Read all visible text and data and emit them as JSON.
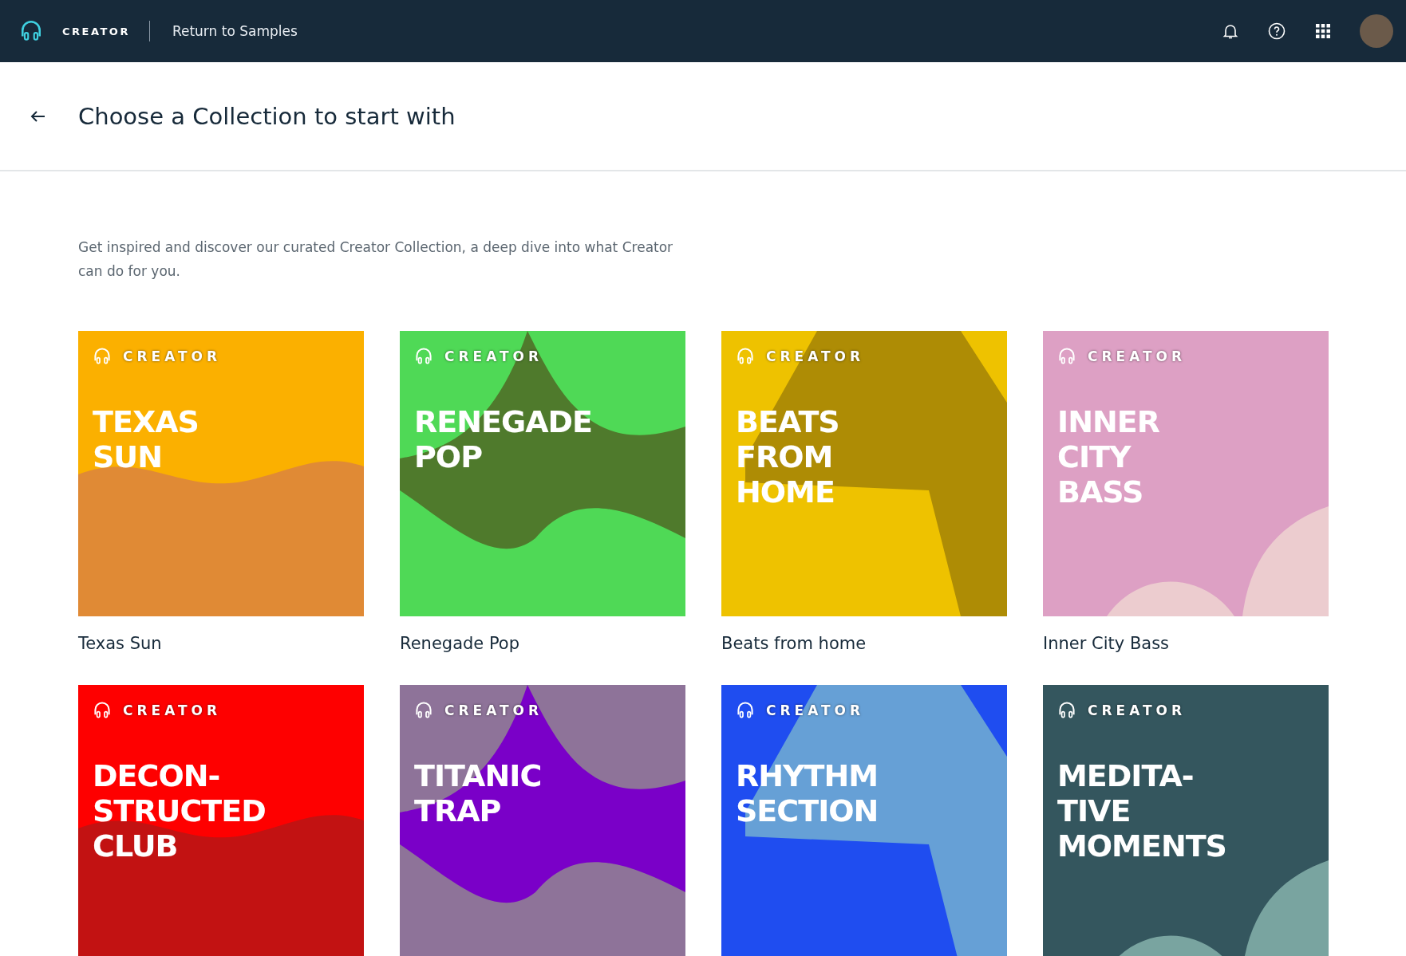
{
  "header": {
    "brand": "CREATOR",
    "link": "Return to Samples"
  },
  "page": {
    "title": "Choose a Collection to start with",
    "description": "Get inspired and discover our curated Creator Collection, a deep dive into what Creator can do for you."
  },
  "collections": [
    {
      "brand": "CREATOR",
      "lines": [
        "TEXAS",
        "SUN"
      ],
      "label": "Texas Sun",
      "color": "#fbb000",
      "shape": {
        "color": "#e08a35"
      }
    },
    {
      "brand": "CREATOR",
      "lines": [
        "RENEGADE",
        "POP"
      ],
      "label": "Renegade Pop",
      "color": "#4fd956",
      "shape": {
        "color": "#4f7a2c"
      }
    },
    {
      "brand": "CREATOR",
      "lines": [
        "BEATS",
        "FROM",
        "HOME"
      ],
      "label": "Beats from home",
      "color": "#eec200",
      "shape": {
        "color": "#ae8c05"
      }
    },
    {
      "brand": "CREATOR",
      "lines": [
        "INNER",
        "CITY",
        "BASS"
      ],
      "label": "Inner City Bass",
      "color": "#dda0c4",
      "shape": {
        "color": "#eccccf"
      }
    },
    {
      "brand": "CREATOR",
      "lines": [
        "DECON-",
        "STRUCTED",
        "CLUB"
      ],
      "color": "#fe0000",
      "shape": {
        "color": "#c21212"
      }
    },
    {
      "brand": "CREATOR",
      "lines": [
        "TITANIC",
        "TRAP"
      ],
      "color": "#8e7399",
      "shape": {
        "color": "#7a00c8"
      }
    },
    {
      "brand": "CREATOR",
      "lines": [
        "RHYTHM",
        "SECTION"
      ],
      "color": "#1f4df0",
      "shape": {
        "color": "#66a0d6"
      }
    },
    {
      "brand": "CREATOR",
      "lines": [
        "MEDITA-",
        "TIVE",
        "MOMENTS"
      ],
      "color": "#34565e",
      "shape": {
        "color": "#79a4a0"
      }
    }
  ]
}
